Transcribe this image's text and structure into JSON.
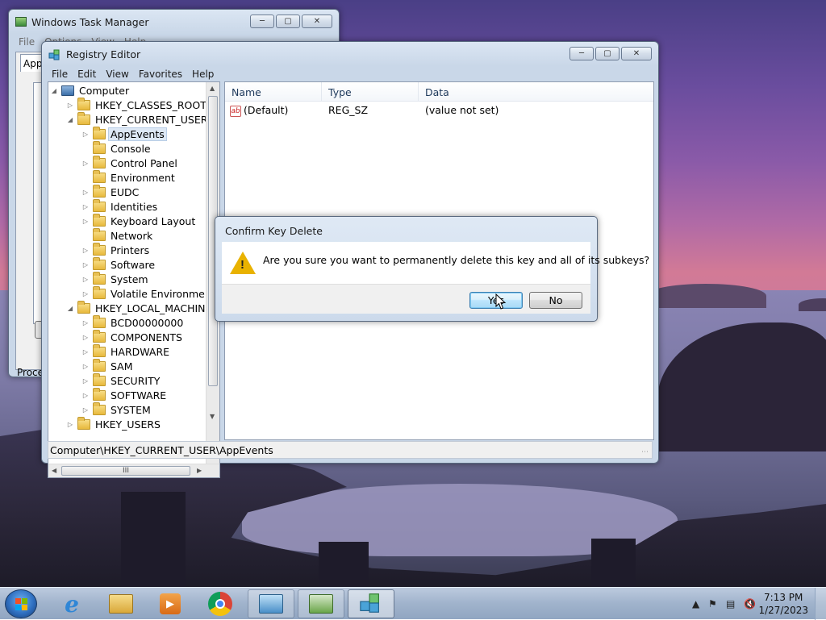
{
  "taskmgr": {
    "title": "Windows Task Manager",
    "menu": [
      "File",
      "Options",
      "View",
      "Help"
    ],
    "tab_partial": "App",
    "bottom_text_partial": "Proce"
  },
  "regedit": {
    "title": "Registry Editor",
    "menu": [
      "File",
      "Edit",
      "View",
      "Favorites",
      "Help"
    ],
    "tree": {
      "root": "Computer",
      "items": [
        {
          "label": "HKEY_CLASSES_ROOT",
          "level": 1,
          "expander": "closed"
        },
        {
          "label": "HKEY_CURRENT_USER",
          "level": 1,
          "expander": "open"
        },
        {
          "label": "AppEvents",
          "level": 2,
          "expander": "closed",
          "selected": true
        },
        {
          "label": "Console",
          "level": 2,
          "expander": "none"
        },
        {
          "label": "Control Panel",
          "level": 2,
          "expander": "closed"
        },
        {
          "label": "Environment",
          "level": 2,
          "expander": "none"
        },
        {
          "label": "EUDC",
          "level": 2,
          "expander": "closed"
        },
        {
          "label": "Identities",
          "level": 2,
          "expander": "closed"
        },
        {
          "label": "Keyboard Layout",
          "level": 2,
          "expander": "closed"
        },
        {
          "label": "Network",
          "level": 2,
          "expander": "none"
        },
        {
          "label": "Printers",
          "level": 2,
          "expander": "closed"
        },
        {
          "label": "Software",
          "level": 2,
          "expander": "closed"
        },
        {
          "label": "System",
          "level": 2,
          "expander": "closed"
        },
        {
          "label": "Volatile Environment",
          "level": 2,
          "expander": "closed"
        },
        {
          "label": "HKEY_LOCAL_MACHINE",
          "level": 1,
          "expander": "open"
        },
        {
          "label": "BCD00000000",
          "level": 2,
          "expander": "closed"
        },
        {
          "label": "COMPONENTS",
          "level": 2,
          "expander": "closed"
        },
        {
          "label": "HARDWARE",
          "level": 2,
          "expander": "closed"
        },
        {
          "label": "SAM",
          "level": 2,
          "expander": "closed"
        },
        {
          "label": "SECURITY",
          "level": 2,
          "expander": "closed"
        },
        {
          "label": "SOFTWARE",
          "level": 2,
          "expander": "closed"
        },
        {
          "label": "SYSTEM",
          "level": 2,
          "expander": "closed"
        },
        {
          "label": "HKEY_USERS",
          "level": 1,
          "expander": "closed"
        }
      ]
    },
    "columns": {
      "name": "Name",
      "type": "Type",
      "data": "Data"
    },
    "values": [
      {
        "name": "(Default)",
        "type": "REG_SZ",
        "data": "(value not set)"
      }
    ],
    "scroll_thumb_glyph": "III",
    "status_path": "Computer\\HKEY_CURRENT_USER\\AppEvents"
  },
  "dialog": {
    "title": "Confirm Key Delete",
    "message": "Are you sure you want to permanently delete this key and all of its subkeys?",
    "yes_label": "Yes",
    "no_label": "No",
    "icon": "warning-icon"
  },
  "taskbar": {
    "pinned": [
      "internet-explorer-icon",
      "windows-explorer-icon",
      "media-player-icon",
      "chrome-icon",
      "control-panel-icon",
      "task-manager-icon",
      "registry-editor-icon"
    ],
    "time": "7:13 PM",
    "date": "1/27/2023",
    "tray_icons": [
      "show-hidden-icons",
      "action-center-flag-icon",
      "network-icon",
      "volume-muted-icon"
    ]
  }
}
